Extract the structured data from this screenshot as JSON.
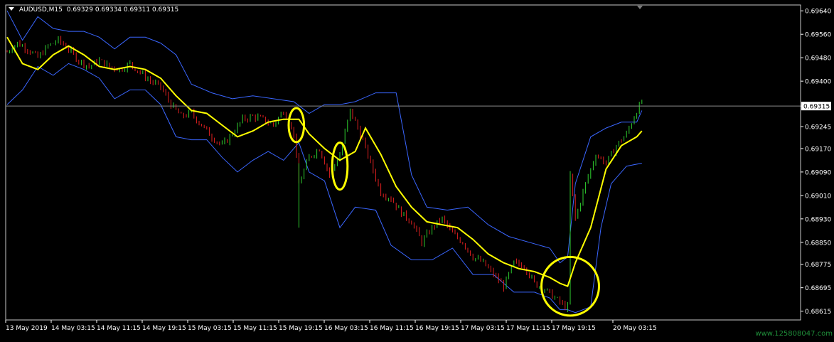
{
  "header": {
    "symbol": "AUDUSD,M15",
    "ohlc": "0.69329 0.69334 0.69311 0.69315"
  },
  "watermark": "www.125808047.com",
  "colors": {
    "background": "#000000",
    "bull": "#2fd12f",
    "bear": "#e02020",
    "ma": "#ffff00",
    "band": "#3a66ff",
    "axis": "#ffffff",
    "circle": "#ffff00"
  },
  "chart_data": {
    "type": "candlestick",
    "ylim": [
      0.68585,
      0.6966
    ],
    "y_ticks": [
      "0.69640",
      "0.69560",
      "0.69480",
      "0.69400",
      "0.69315",
      "0.69245",
      "0.69170",
      "0.69090",
      "0.69010",
      "0.68930",
      "0.68850",
      "0.68775",
      "0.68695",
      "0.68615"
    ],
    "current_price": "0.69315",
    "x_ticks": [
      "13 May 2019",
      "14 May 03:15",
      "14 May 11:15",
      "14 May 19:15",
      "15 May 03:15",
      "15 May 11:15",
      "15 May 19:15",
      "16 May 03:15",
      "16 May 11:15",
      "16 May 19:15",
      "17 May 03:15",
      "17 May 11:15",
      "17 May 19:15",
      "20 May 03:15"
    ],
    "close_path": [
      [
        0,
        0.695
      ],
      [
        4,
        0.6953
      ],
      [
        8,
        0.6951
      ],
      [
        12,
        0.6948
      ],
      [
        16,
        0.6952
      ],
      [
        20,
        0.6954
      ],
      [
        24,
        0.6951
      ],
      [
        28,
        0.6947
      ],
      [
        32,
        0.6945
      ],
      [
        36,
        0.6947
      ],
      [
        40,
        0.6945
      ],
      [
        44,
        0.6944
      ],
      [
        48,
        0.6946
      ],
      [
        52,
        0.6943
      ],
      [
        56,
        0.694
      ],
      [
        60,
        0.6938
      ],
      [
        64,
        0.6932
      ],
      [
        68,
        0.6928
      ],
      [
        72,
        0.6929
      ],
      [
        76,
        0.6925
      ],
      [
        80,
        0.6921
      ],
      [
        84,
        0.6918
      ],
      [
        88,
        0.6922
      ],
      [
        92,
        0.6927
      ],
      [
        96,
        0.6928
      ],
      [
        100,
        0.6927
      ],
      [
        104,
        0.6925
      ],
      [
        108,
        0.693
      ],
      [
        112,
        0.6922
      ],
      [
        114,
        0.6905
      ],
      [
        118,
        0.6914
      ],
      [
        122,
        0.6917
      ],
      [
        126,
        0.6908
      ],
      [
        130,
        0.6915
      ],
      [
        134,
        0.693
      ],
      [
        138,
        0.6922
      ],
      [
        142,
        0.6912
      ],
      [
        146,
        0.6902
      ],
      [
        150,
        0.69
      ],
      [
        154,
        0.6895
      ],
      [
        158,
        0.6892
      ],
      [
        162,
        0.6885
      ],
      [
        166,
        0.689
      ],
      [
        170,
        0.6893
      ],
      [
        174,
        0.6888
      ],
      [
        178,
        0.6885
      ],
      [
        182,
        0.688
      ],
      [
        186,
        0.6878
      ],
      [
        190,
        0.6874
      ],
      [
        194,
        0.687
      ],
      [
        198,
        0.6878
      ],
      [
        202,
        0.6877
      ],
      [
        206,
        0.6871
      ],
      [
        210,
        0.6869
      ],
      [
        214,
        0.6866
      ],
      [
        218,
        0.6863
      ],
      [
        219,
        0.6863
      ],
      [
        220,
        0.6908
      ],
      [
        222,
        0.6893
      ],
      [
        226,
        0.6905
      ],
      [
        230,
        0.6915
      ],
      [
        234,
        0.6912
      ],
      [
        238,
        0.6918
      ],
      [
        242,
        0.6922
      ],
      [
        246,
        0.693
      ],
      [
        248,
        0.6933
      ]
    ],
    "ma_path": [
      [
        0,
        0.6955
      ],
      [
        6,
        0.6946
      ],
      [
        12,
        0.6944
      ],
      [
        18,
        0.6949
      ],
      [
        24,
        0.6952
      ],
      [
        30,
        0.6949
      ],
      [
        36,
        0.6945
      ],
      [
        42,
        0.6944
      ],
      [
        48,
        0.6945
      ],
      [
        54,
        0.6944
      ],
      [
        60,
        0.6941
      ],
      [
        66,
        0.6935
      ],
      [
        72,
        0.693
      ],
      [
        78,
        0.6929
      ],
      [
        84,
        0.6925
      ],
      [
        90,
        0.6921
      ],
      [
        96,
        0.6923
      ],
      [
        102,
        0.6926
      ],
      [
        108,
        0.6927
      ],
      [
        114,
        0.6927
      ],
      [
        118,
        0.6922
      ],
      [
        124,
        0.6917
      ],
      [
        130,
        0.6913
      ],
      [
        136,
        0.6916
      ],
      [
        140,
        0.6924
      ],
      [
        146,
        0.6915
      ],
      [
        152,
        0.6904
      ],
      [
        158,
        0.6897
      ],
      [
        164,
        0.6892
      ],
      [
        170,
        0.6891
      ],
      [
        176,
        0.689
      ],
      [
        182,
        0.6886
      ],
      [
        188,
        0.6881
      ],
      [
        194,
        0.6878
      ],
      [
        200,
        0.6876
      ],
      [
        206,
        0.6875
      ],
      [
        212,
        0.6873
      ],
      [
        216,
        0.6871
      ],
      [
        219,
        0.687
      ],
      [
        222,
        0.6878
      ],
      [
        228,
        0.689
      ],
      [
        234,
        0.691
      ],
      [
        240,
        0.6918
      ],
      [
        246,
        0.6921
      ],
      [
        248,
        0.6923
      ]
    ],
    "upper_band": [
      [
        0,
        0.6964
      ],
      [
        6,
        0.6954
      ],
      [
        12,
        0.6962
      ],
      [
        18,
        0.6958
      ],
      [
        24,
        0.6957
      ],
      [
        30,
        0.6957
      ],
      [
        36,
        0.6955
      ],
      [
        42,
        0.6951
      ],
      [
        48,
        0.6955
      ],
      [
        54,
        0.6955
      ],
      [
        60,
        0.6953
      ],
      [
        66,
        0.6949
      ],
      [
        72,
        0.6939
      ],
      [
        80,
        0.6936
      ],
      [
        88,
        0.6934
      ],
      [
        96,
        0.6935
      ],
      [
        104,
        0.6934
      ],
      [
        112,
        0.6933
      ],
      [
        118,
        0.6929
      ],
      [
        124,
        0.6932
      ],
      [
        130,
        0.6932
      ],
      [
        136,
        0.6933
      ],
      [
        144,
        0.6936
      ],
      [
        152,
        0.6936
      ],
      [
        158,
        0.6908
      ],
      [
        164,
        0.6897
      ],
      [
        172,
        0.6896
      ],
      [
        180,
        0.6897
      ],
      [
        188,
        0.6891
      ],
      [
        196,
        0.6887
      ],
      [
        204,
        0.6885
      ],
      [
        212,
        0.6883
      ],
      [
        216,
        0.6878
      ],
      [
        219,
        0.688
      ],
      [
        222,
        0.6905
      ],
      [
        228,
        0.6921
      ],
      [
        234,
        0.6924
      ],
      [
        240,
        0.6926
      ],
      [
        246,
        0.6926
      ],
      [
        248,
        0.693
      ]
    ],
    "lower_band": [
      [
        0,
        0.6932
      ],
      [
        6,
        0.6937
      ],
      [
        12,
        0.6945
      ],
      [
        18,
        0.6942
      ],
      [
        24,
        0.6946
      ],
      [
        30,
        0.6944
      ],
      [
        36,
        0.6941
      ],
      [
        42,
        0.6934
      ],
      [
        48,
        0.6937
      ],
      [
        54,
        0.6937
      ],
      [
        60,
        0.6932
      ],
      [
        66,
        0.6921
      ],
      [
        72,
        0.692
      ],
      [
        78,
        0.692
      ],
      [
        84,
        0.6914
      ],
      [
        90,
        0.6909
      ],
      [
        96,
        0.6913
      ],
      [
        102,
        0.6916
      ],
      [
        108,
        0.6913
      ],
      [
        114,
        0.6919
      ],
      [
        118,
        0.6909
      ],
      [
        124,
        0.6906
      ],
      [
        130,
        0.689
      ],
      [
        136,
        0.6897
      ],
      [
        144,
        0.6896
      ],
      [
        150,
        0.6884
      ],
      [
        158,
        0.6879
      ],
      [
        166,
        0.6879
      ],
      [
        174,
        0.6883
      ],
      [
        182,
        0.6874
      ],
      [
        190,
        0.6874
      ],
      [
        198,
        0.6868
      ],
      [
        206,
        0.6868
      ],
      [
        212,
        0.6866
      ],
      [
        216,
        0.6862
      ],
      [
        219,
        0.6862
      ],
      [
        222,
        0.6861
      ],
      [
        228,
        0.6863
      ],
      [
        232,
        0.689
      ],
      [
        236,
        0.6905
      ],
      [
        242,
        0.6911
      ],
      [
        248,
        0.6912
      ]
    ],
    "bar_count": 249,
    "annotations": [
      {
        "shape": "ellipse",
        "bar": 113,
        "price": 0.6925,
        "rx_bars": 3,
        "ry_price": 0.00058
      },
      {
        "shape": "ellipse",
        "bar": 130,
        "price": 0.6911,
        "rx_bars": 3,
        "ry_price": 0.0008
      },
      {
        "shape": "circle",
        "bar": 220,
        "price": 0.687,
        "rx_bars": 9,
        "ry_price": 0.001
      }
    ]
  }
}
